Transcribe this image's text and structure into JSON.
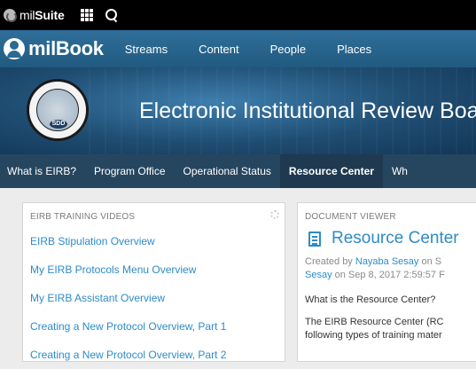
{
  "topbar": {
    "brand_icon": "milsuite-logo-icon",
    "brand_bold": "mil",
    "brand_rest": "Suite",
    "apps_icon": "grid-icon",
    "search_icon": "search-icon"
  },
  "navbar": {
    "brand": "milBook",
    "brand_icon": "person-circle-icon",
    "links": [
      "Streams",
      "Content",
      "People",
      "Places"
    ]
  },
  "banner": {
    "title": "Electronic Institutional Review Board",
    "seal_text": "SDD"
  },
  "subnav": {
    "items": [
      "What is EIRB?",
      "Program Office",
      "Operational Status",
      "Resource Center",
      "Wh"
    ],
    "active": "Resource Center"
  },
  "training_videos": {
    "header": "EIRB TRAINING VIDEOS",
    "items": [
      "EIRB Stipulation Overview",
      "My EIRB Protocols Menu Overview",
      "My EIRB Assistant Overview",
      "Creating a New Protocol Overview, Part 1",
      "Creating a New Protocol Overview, Part 2"
    ]
  },
  "document_viewer": {
    "header": "DOCUMENT VIEWER",
    "title": "Resource Center",
    "meta_prefix": "Created by ",
    "meta_author": "Nayaba Sesay",
    "meta_mid": " on S",
    "meta_line2_author": "Sesay",
    "meta_line2_rest": " on Sep 8, 2017 2:59:57 F",
    "question": "What is the Resource Center?",
    "body_line1": "The EIRB Resource Center (RC",
    "body_line2": "following types of training mater"
  },
  "colors": {
    "link": "#2d8bc8",
    "navbar": "#2a6a94",
    "subnav": "#26465f"
  }
}
